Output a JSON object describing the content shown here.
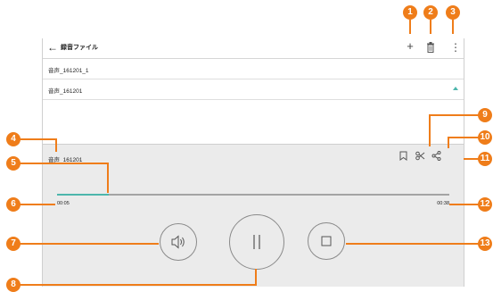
{
  "toolbar": {
    "back_icon": "arrow-left-icon",
    "title": "録音ファイル",
    "add_glyph": "+",
    "delete_icon": "trash-icon",
    "more_glyph": "⋮"
  },
  "recordings": [
    {
      "name": "音声_161201_1"
    },
    {
      "name": "音声_161201",
      "selected": true
    }
  ],
  "player": {
    "file_name": "音声_161201",
    "elapsed": "00:05",
    "total": "00:38",
    "progress": 0.132,
    "icons": [
      "bookmark-icon",
      "scissors-icon",
      "share-icon",
      "speaker-icon",
      "pause-icon",
      "stop-icon"
    ]
  },
  "colors": {
    "accent": "#4db6ac",
    "callout": "#ef7d1a",
    "player_bg": "#ebebeb"
  },
  "callouts": [
    "1",
    "2",
    "3",
    "4",
    "5",
    "6",
    "7",
    "8",
    "9",
    "10",
    "11",
    "12",
    "13"
  ]
}
